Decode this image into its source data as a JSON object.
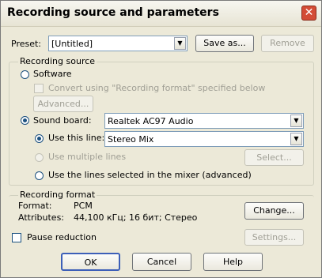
{
  "window": {
    "title": "Recording source and parameters"
  },
  "preset": {
    "label": "Preset:",
    "value": "[Untitled]",
    "save_as": "Save as...",
    "remove": "Remove"
  },
  "recording_source": {
    "group_title": "Recording source",
    "software": {
      "label": "Software",
      "convert_label": "Convert using \"Recording format\" specified below",
      "advanced": "Advanced..."
    },
    "sound_board": {
      "label": "Sound board:",
      "value": "Realtek AC97 Audio"
    },
    "use_this_line": {
      "label": "Use this line:",
      "value": "Stereo Mix"
    },
    "use_multiple_lines": {
      "label": "Use multiple lines",
      "select": "Select..."
    },
    "use_mixer_lines": {
      "label": "Use the lines selected in the mixer (advanced)"
    }
  },
  "recording_format": {
    "group_title": "Recording format",
    "format_label": "Format:",
    "format_value": "PCM",
    "attributes_label": "Attributes:",
    "attributes_value": "44,100 кГц; 16 бит; Стерео",
    "change": "Change..."
  },
  "pause_reduction": {
    "label": "Pause reduction",
    "settings": "Settings..."
  },
  "footer": {
    "ok": "OK",
    "cancel": "Cancel",
    "help": "Help"
  }
}
